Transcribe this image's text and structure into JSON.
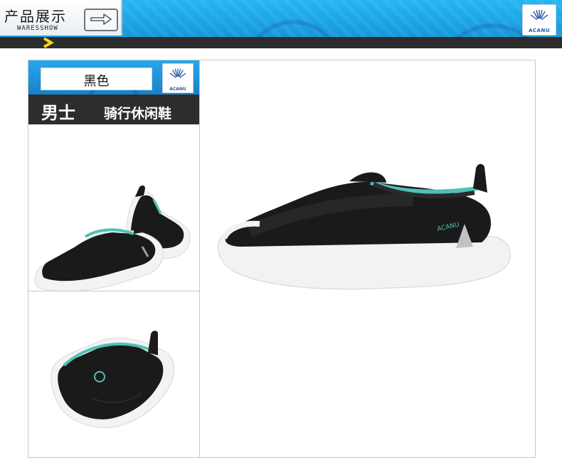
{
  "header": {
    "title": "产品展示",
    "subtitle": "WARESSHOW",
    "brand": "ACANU"
  },
  "product": {
    "color_name": "黑色",
    "gender": "男士",
    "type": "骑行休闲鞋",
    "brand_mark": "ACANU"
  },
  "images": [
    {
      "name": "shoe-pair-side-view"
    },
    {
      "name": "shoe-three-quarter-view"
    },
    {
      "name": "shoe-large-side-view"
    }
  ],
  "colors": {
    "banner_blue": "#1aa6e6",
    "dark_strip": "#2c2c2c",
    "accent_yellow": "#f5d21a",
    "shoe_black": "#1a1a1a",
    "shoe_trim_teal": "#4fc1b6",
    "sole_white": "#f2f2f2"
  }
}
